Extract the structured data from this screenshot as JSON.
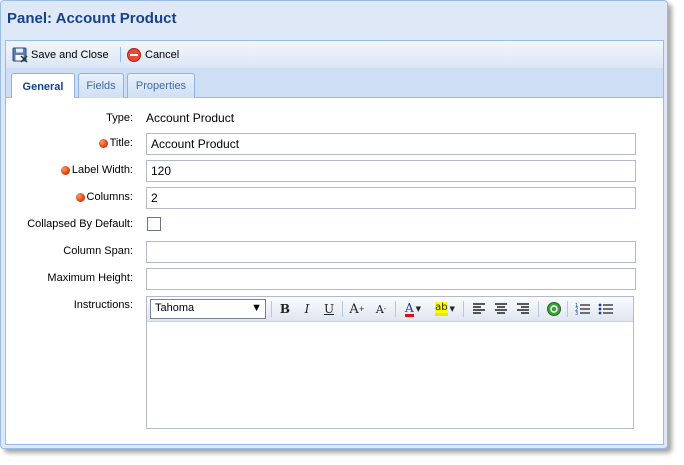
{
  "window": {
    "title": "Panel: Account Product"
  },
  "toolbar": {
    "save_label": "Save and Close",
    "cancel_label": "Cancel"
  },
  "tabs": [
    {
      "label": "General",
      "active": true
    },
    {
      "label": "Fields",
      "active": false
    },
    {
      "label": "Properties",
      "active": false
    }
  ],
  "form": {
    "type_label": "Type:",
    "type_value": "Account Product",
    "title_label": "Title:",
    "title_value": "Account Product",
    "label_width_label": "Label Width:",
    "label_width_value": "120",
    "columns_label": "Columns:",
    "columns_value": "2",
    "collapsed_label": "Collapsed By Default:",
    "collapsed_checked": false,
    "column_span_label": "Column Span:",
    "column_span_value": "",
    "max_height_label": "Maximum Height:",
    "max_height_value": "",
    "instructions_label": "Instructions:"
  },
  "editor": {
    "font_value": "Tahoma",
    "buttons": [
      "bold-icon",
      "italic-icon",
      "underline-icon",
      "grow-text-icon",
      "shrink-text-icon",
      "font-color-icon",
      "highlight-icon",
      "align-left-icon",
      "align-center-icon",
      "align-right-icon",
      "link-icon",
      "ordered-list-icon",
      "unordered-list-icon"
    ],
    "bold_glyph": "B",
    "italic_glyph": "I",
    "underline_glyph": "U",
    "grow_glyph": "A",
    "shrink_glyph": "A",
    "color_glyph": "A",
    "highlight_glyph": "ab",
    "body": ""
  },
  "colors": {
    "accent": "#15428b",
    "required": "#e0400c",
    "panel_bg": "#dfe8f6"
  }
}
